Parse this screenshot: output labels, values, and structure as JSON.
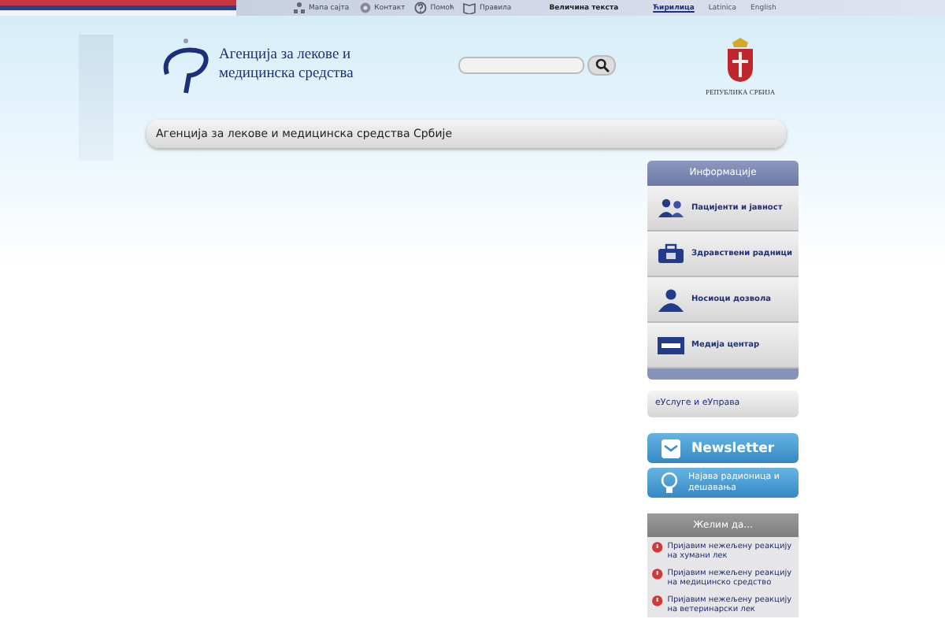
{
  "top_bar": {
    "links": [
      "Мапа сајта",
      "Контакт",
      "Помоћ",
      "Правила"
    ],
    "text_size_label": "Величина текста",
    "languages": [
      {
        "label": "Ћирилица",
        "selected": true
      },
      {
        "label": "Latinica",
        "selected": false
      },
      {
        "label": "English",
        "selected": false
      }
    ]
  },
  "header": {
    "logo_text": "Агенција за лекове и медицинска средства",
    "emblem_caption": "РЕПУБЛИКА СРБИЈА"
  },
  "breadcrumb": "Агенција за лекове и медицинска средства Србије",
  "sidebar": {
    "info_title": "Информације",
    "info_items": [
      "Пацијенти и јавност",
      "Здравствени радници",
      "Носиоци дозвола",
      "Медија центар"
    ],
    "services_link": "еУслуге и еУправа",
    "newsletter": "Newsletter",
    "announcements": "Најава радионица и дешавања",
    "wish_title": "Желим да...",
    "wish_items": [
      "Пријавим нежељену реакцију на хумани лек",
      "Пријавим нежељену реакцију на медицинско средство",
      "Пријавим нежељену реакцију на ветеринарски лек"
    ]
  }
}
